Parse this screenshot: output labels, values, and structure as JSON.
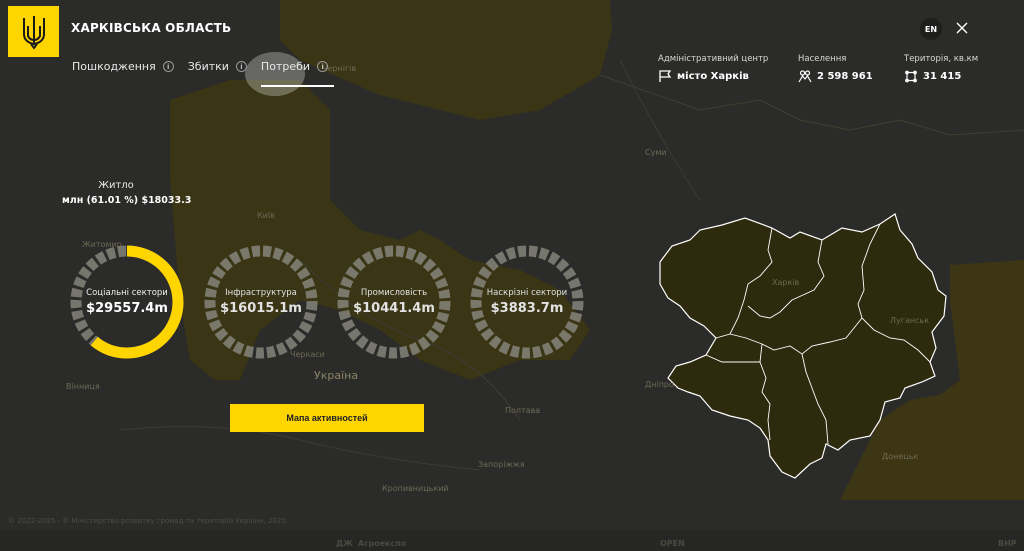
{
  "header": {
    "title": "ХАРКІВСЬКА ОБЛАСТЬ",
    "lang": "EN"
  },
  "tabs": [
    {
      "label": "Пошкодження",
      "active": false
    },
    {
      "label": "Збитки",
      "active": false
    },
    {
      "label": "Потреби",
      "active": true
    }
  ],
  "stats": {
    "center": {
      "label": "Адміністративний центр",
      "value": "місто Харків"
    },
    "population": {
      "label": "Населення",
      "value": "2 598 961"
    },
    "territory": {
      "label": "Територія, кв.км",
      "value": "31 415"
    }
  },
  "housing": {
    "title": "Житло",
    "value": "млн (61.01 %) $18033.3"
  },
  "sectors": [
    {
      "label": "Соціальні сектори",
      "value": "$29557.4m",
      "share": 0.61,
      "color": "#ffd500"
    },
    {
      "label": "Інфраструктура",
      "value": "$16015.1m",
      "share": 0,
      "color": "#ffd500"
    },
    {
      "label": "Промисловість",
      "value": "$10441.4m",
      "share": 0,
      "color": "#ffd500"
    },
    {
      "label": "Наскрізні сектори",
      "value": "$3883.7m",
      "share": 0,
      "color": "#ffd500"
    }
  ],
  "activity_button": "Мапа активностей",
  "footer": "© 2022-2025 · © Міністерство розвитку громад та територій України, 2025",
  "map_labels": {
    "kyiv": "Київ",
    "ukraine": "Україна",
    "chernihiv": "Чернігів",
    "sumy": "Суми",
    "zhytomyr": "Житомир",
    "vinnytsia": "Вінниця",
    "poltava": "Полтава",
    "kharkiv": "Харків",
    "dnipro": "Дніпро",
    "zaporizhzhia": "Запоріжжя",
    "kropyvnytskyi": "Кропивницький",
    "luhansk": "Луганськ",
    "donetsk": "Донецьк",
    "cherkasy": "Черкаси"
  },
  "partners": [
    "ДЖ",
    "Агроекспо",
    "OPEN",
    "ВНР"
  ],
  "colors": {
    "accent": "#ffd500",
    "ring_track": "#7a7a70",
    "map_region": "#3a3412"
  }
}
